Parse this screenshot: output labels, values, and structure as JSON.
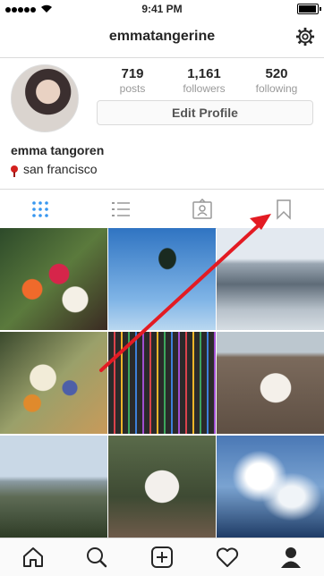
{
  "status_bar": {
    "time": "9:41 PM"
  },
  "header": {
    "username": "emmatangerine"
  },
  "profile": {
    "stats": [
      {
        "value": "719",
        "label": "posts"
      },
      {
        "value": "1,161",
        "label": "followers"
      },
      {
        "value": "520",
        "label": "following"
      }
    ],
    "edit_button_label": "Edit Profile",
    "full_name": "emma tangoren",
    "location": "san francisco"
  },
  "view_tabs": [
    "grid-icon",
    "list-icon",
    "tagged-icon",
    "saved-icon"
  ],
  "bottom_tabs": [
    "home-icon",
    "search-icon",
    "add-icon",
    "heart-icon",
    "profile-icon"
  ],
  "colors": {
    "accent": "#3897f0",
    "arrow": "#e31b23",
    "border": "#dbdbdb"
  }
}
